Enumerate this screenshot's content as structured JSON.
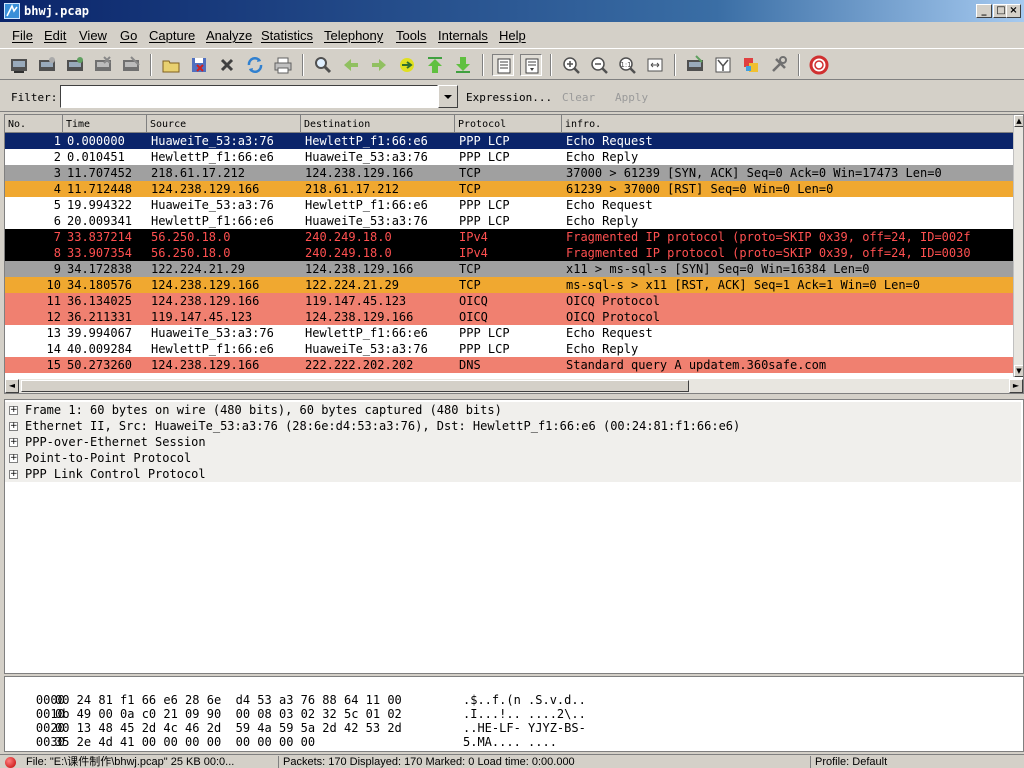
{
  "window": {
    "title": "bhwj.pcap"
  },
  "menu": [
    "File",
    "Edit",
    "View",
    "Go",
    "Capture",
    "Analyze",
    "Statistics",
    "Telephony",
    "Tools",
    "Internals",
    "Help"
  ],
  "filter": {
    "label": "Filter:",
    "value": "",
    "expression": "Expression...",
    "clear": "Clear",
    "apply": "Apply"
  },
  "packet_list": {
    "columns": [
      "No.",
      "Time",
      "Source",
      "Destination",
      "Protocol",
      "infro."
    ],
    "rows": [
      {
        "no": "1",
        "time": "0.000000",
        "src": "HuaweiTe_53:a3:76",
        "dst": "HewlettP_f1:66:e6",
        "proto": "PPP LCP",
        "info": "Echo Request",
        "bg": "#0a246a",
        "fg": "#ffffff"
      },
      {
        "no": "2",
        "time": "0.010451",
        "src": "HewlettP_f1:66:e6",
        "dst": "HuaweiTe_53:a3:76",
        "proto": "PPP LCP",
        "info": "Echo Reply",
        "bg": "#ffffff",
        "fg": "#000000"
      },
      {
        "no": "3",
        "time": "11.707452",
        "src": "218.61.17.212",
        "dst": "124.238.129.166",
        "proto": "TCP",
        "info": "37000 > 61239 [SYN, ACK] Seq=0 Ack=0 Win=17473 Len=0",
        "bg": "#a0a0a0",
        "fg": "#000000"
      },
      {
        "no": "4",
        "time": "11.712448",
        "src": "124.238.129.166",
        "dst": "218.61.17.212",
        "proto": "TCP",
        "info": "61239 > 37000 [RST] Seq=0 Win=0 Len=0",
        "bg": "#f0a830",
        "fg": "#000000"
      },
      {
        "no": "5",
        "time": "19.994322",
        "src": "HuaweiTe_53:a3:76",
        "dst": "HewlettP_f1:66:e6",
        "proto": "PPP LCP",
        "info": "Echo Request",
        "bg": "#ffffff",
        "fg": "#000000"
      },
      {
        "no": "6",
        "time": "20.009341",
        "src": "HewlettP_f1:66:e6",
        "dst": "HuaweiTe_53:a3:76",
        "proto": "PPP LCP",
        "info": "Echo Reply",
        "bg": "#ffffff",
        "fg": "#000000"
      },
      {
        "no": "7",
        "time": "33.837214",
        "src": "56.250.18.0",
        "dst": "240.249.18.0",
        "proto": "IPv4",
        "info": "Fragmented IP protocol (proto=SKIP 0x39, off=24, ID=002f",
        "bg": "#000000",
        "fg": "#ff5050"
      },
      {
        "no": "8",
        "time": "33.907354",
        "src": "56.250.18.0",
        "dst": "240.249.18.0",
        "proto": "IPv4",
        "info": "Fragmented IP protocol (proto=SKIP 0x39, off=24, ID=0030",
        "bg": "#000000",
        "fg": "#ff5050"
      },
      {
        "no": "9",
        "time": "34.172838",
        "src": "122.224.21.29",
        "dst": "124.238.129.166",
        "proto": "TCP",
        "info": "x11 > ms-sql-s [SYN] Seq=0 Win=16384 Len=0",
        "bg": "#a0a0a0",
        "fg": "#000000"
      },
      {
        "no": "10",
        "time": "34.180576",
        "src": "124.238.129.166",
        "dst": "122.224.21.29",
        "proto": "TCP",
        "info": "ms-sql-s > x11 [RST, ACK] Seq=1 Ack=1 Win=0 Len=0",
        "bg": "#f0a830",
        "fg": "#000000"
      },
      {
        "no": "11",
        "time": "36.134025",
        "src": "124.238.129.166",
        "dst": "119.147.45.123",
        "proto": "OICQ",
        "info": "OICQ Protocol",
        "bg": "#f08070",
        "fg": "#000000"
      },
      {
        "no": "12",
        "time": "36.211331",
        "src": "119.147.45.123",
        "dst": "124.238.129.166",
        "proto": "OICQ",
        "info": "OICQ Protocol",
        "bg": "#f08070",
        "fg": "#000000"
      },
      {
        "no": "13",
        "time": "39.994067",
        "src": "HuaweiTe_53:a3:76",
        "dst": "HewlettP_f1:66:e6",
        "proto": "PPP LCP",
        "info": "Echo Request",
        "bg": "#ffffff",
        "fg": "#000000"
      },
      {
        "no": "14",
        "time": "40.009284",
        "src": "HewlettP_f1:66:e6",
        "dst": "HuaweiTe_53:a3:76",
        "proto": "PPP LCP",
        "info": "Echo Reply",
        "bg": "#ffffff",
        "fg": "#000000"
      },
      {
        "no": "15",
        "time": "50.273260",
        "src": "124.238.129.166",
        "dst": "222.222.202.202",
        "proto": "DNS",
        "info": "Standard query A updatem.360safe.com",
        "bg": "#f08070",
        "fg": "#000000"
      }
    ]
  },
  "detail": [
    "Frame 1: 60 bytes on wire (480 bits), 60 bytes captured (480 bits)",
    "Ethernet II, Src: HuaweiTe_53:a3:76 (28:6e:d4:53:a3:76), Dst: HewlettP_f1:66:e6 (00:24:81:f1:66:e6)",
    "PPP-over-Ethernet Session",
    "Point-to-Point Protocol",
    "PPP Link Control Protocol"
  ],
  "bytes": [
    {
      "offset": "0000",
      "hex": "00 24 81 f1 66 e6 28 6e  d4 53 a3 76 88 64 11 00",
      "ascii": ".$..f.(n .S.v.d.."
    },
    {
      "offset": "0010",
      "hex": "0b 49 00 0a c0 21 09 90  00 08 03 02 32 5c 01 02",
      "ascii": ".I...!.. ....2\\.."
    },
    {
      "offset": "0020",
      "hex": "00 13 48 45 2d 4c 46 2d  59 4a 59 5a 2d 42 53 2d",
      "ascii": "..HE-LF- YJYZ-BS-"
    },
    {
      "offset": "0030",
      "hex": "35 2e 4d 41 00 00 00 00  00 00 00 00",
      "ascii": "5.MA.... ...."
    }
  ],
  "status": {
    "file": "File: \"E:\\课件制作\\bhwj.pcap\" 25 KB 00:0...",
    "packets": "Packets: 170 Displayed: 170 Marked: 0 Load time: 0:00.000",
    "profile": "Profile: Default"
  }
}
